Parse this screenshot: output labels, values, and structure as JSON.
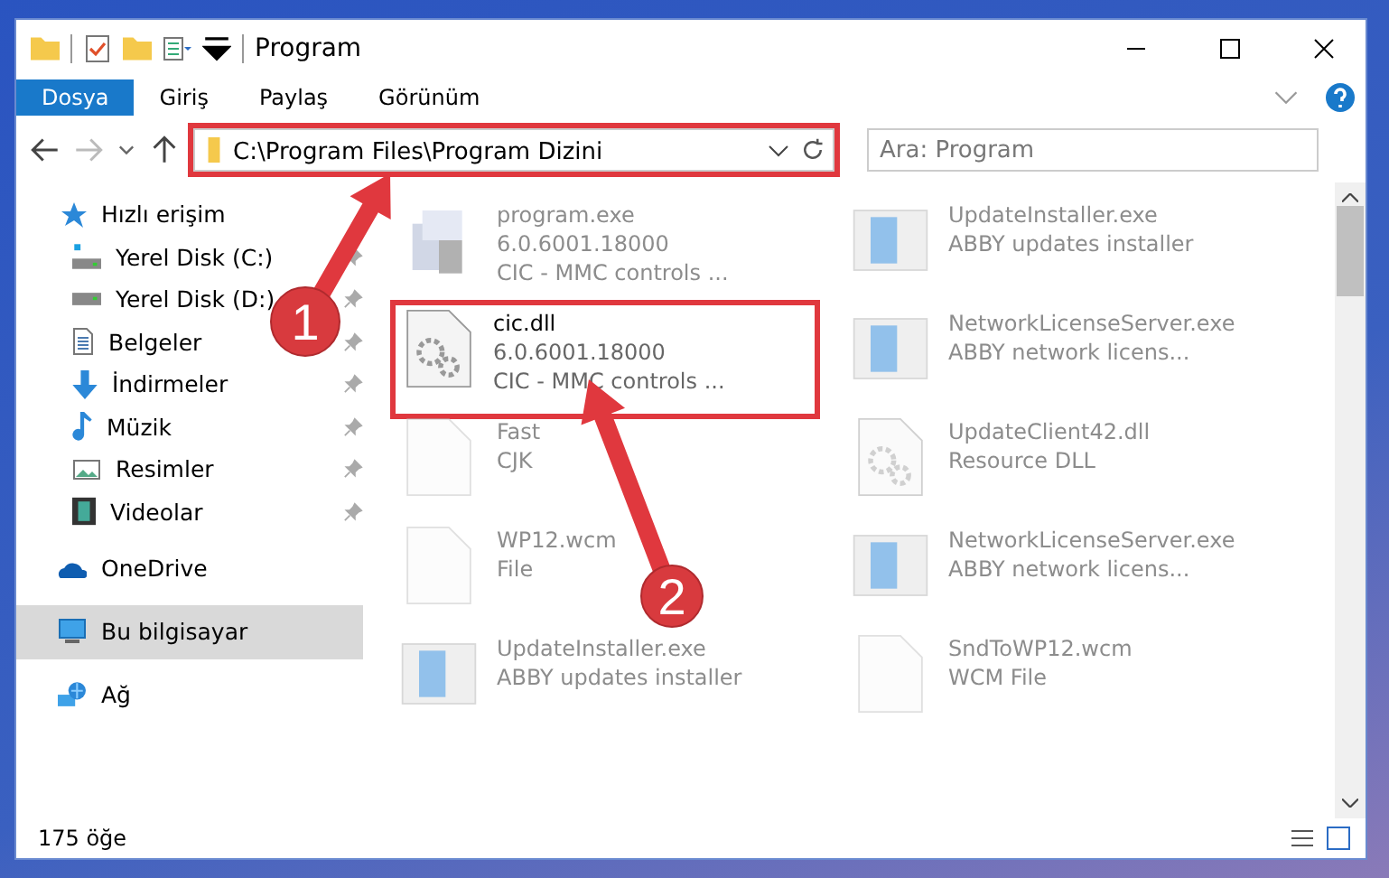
{
  "window": {
    "title": "Program"
  },
  "ribbon_tabs": [
    {
      "label": "Dosya",
      "selected": true
    },
    {
      "label": "Giriş",
      "selected": false
    },
    {
      "label": "Paylaş",
      "selected": false
    },
    {
      "label": "Görünüm",
      "selected": false
    }
  ],
  "address": {
    "path": "C:\\Program Files\\Program Dizini",
    "highlighted": true
  },
  "search": {
    "placeholder": "Ara: Program"
  },
  "nav": [
    {
      "label": "Hızlı erişim",
      "kind": "star",
      "pinned": false,
      "selected": false,
      "children": [
        {
          "label": "Yerel Disk (C:)",
          "kind": "drive-c",
          "pinned": true,
          "selected": false
        },
        {
          "label": "Yerel Disk (D:)",
          "kind": "drive",
          "pinned": true,
          "selected": false
        },
        {
          "label": "Belgeler",
          "kind": "docs",
          "pinned": true,
          "selected": false
        },
        {
          "label": "İndirmeler",
          "kind": "download",
          "pinned": true,
          "selected": false
        },
        {
          "label": "Müzik",
          "kind": "music",
          "pinned": true,
          "selected": false
        },
        {
          "label": "Resimler",
          "kind": "pictures",
          "pinned": true,
          "selected": false
        },
        {
          "label": "Videolar",
          "kind": "video",
          "pinned": true,
          "selected": false
        }
      ]
    },
    {
      "label": "OneDrive",
      "kind": "cloud",
      "pinned": false,
      "selected": false
    },
    {
      "label": "Bu bilgisayar",
      "kind": "pc",
      "pinned": false,
      "selected": true
    },
    {
      "label": "Ağ",
      "kind": "network",
      "pinned": false,
      "selected": false
    }
  ],
  "files": [
    {
      "name": "program.exe",
      "lines": [
        "6.0.6001.18000",
        "CIC - MMC controls ..."
      ],
      "kind": "setup",
      "blurred": true,
      "highlighted": false
    },
    {
      "name": "UpdateInstaller.exe",
      "lines": [
        "ABBY updates installer"
      ],
      "kind": "window",
      "blurred": true,
      "highlighted": false
    },
    {
      "name": "cic.dll",
      "lines": [
        "6.0.6001.18000",
        "CIC - MMC controls ..."
      ],
      "kind": "dll",
      "blurred": false,
      "highlighted": true
    },
    {
      "name": "NetworkLicenseServer.exe",
      "lines": [
        "ABBY network licens..."
      ],
      "kind": "window",
      "blurred": true,
      "highlighted": false
    },
    {
      "name": "Fast",
      "lines": [
        "CJK"
      ],
      "kind": "blank",
      "blurred": true,
      "highlighted": false
    },
    {
      "name": "UpdateClient42.dll",
      "lines": [
        "Resource DLL"
      ],
      "kind": "dll",
      "blurred": true,
      "highlighted": false
    },
    {
      "name": "WP12.wcm",
      "lines": [
        "File"
      ],
      "kind": "blank",
      "blurred": true,
      "highlighted": false
    },
    {
      "name": "NetworkLicenseServer.exe",
      "lines": [
        "ABBY network licens..."
      ],
      "kind": "window",
      "blurred": true,
      "highlighted": false
    },
    {
      "name": "UpdateInstaller.exe",
      "lines": [
        "ABBY updates installer"
      ],
      "kind": "window",
      "blurred": true,
      "highlighted": false
    },
    {
      "name": "SndToWP12.wcm",
      "lines": [
        "WCM File"
      ],
      "kind": "blank",
      "blurred": true,
      "highlighted": false
    }
  ],
  "status_bar": {
    "count": "175 öğe"
  },
  "callouts": [
    {
      "number": "1"
    },
    {
      "number": "2"
    }
  ]
}
